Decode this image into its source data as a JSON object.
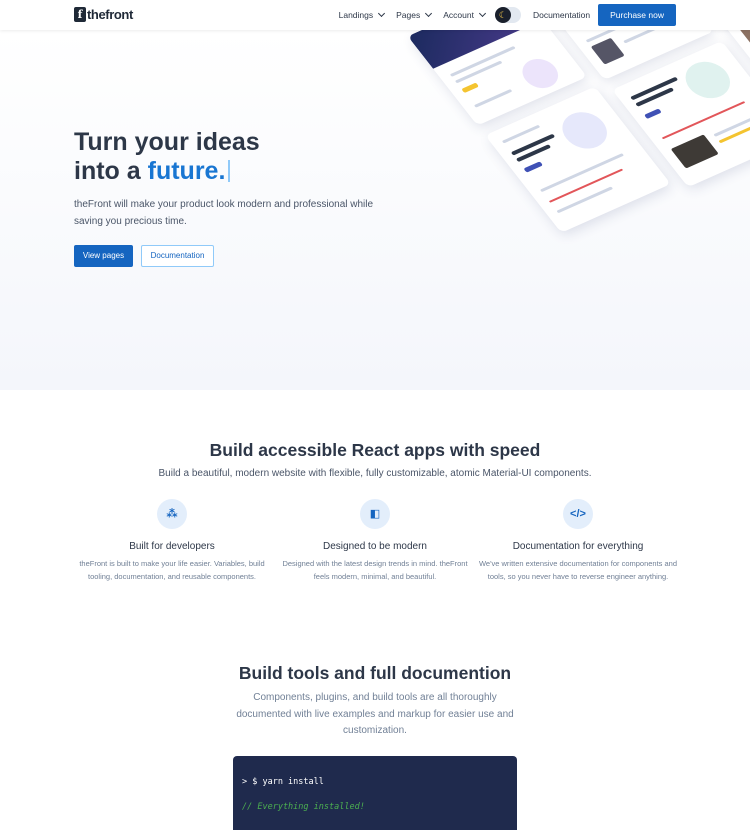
{
  "header": {
    "logo_mark": "f",
    "logo_text": "thefront",
    "nav": [
      {
        "label": "Landings"
      },
      {
        "label": "Pages"
      },
      {
        "label": "Account"
      }
    ],
    "theme_toggle_icon": "moon-icon",
    "documentation": "Documentation",
    "purchase": "Purchase now"
  },
  "hero": {
    "title_line1": "Turn your ideas",
    "title_line2_prefix": "into a",
    "title_accent": "future.",
    "subtitle": "theFront will make your product look modern and professional while saving you precious time.",
    "primary_button": "View pages",
    "secondary_button": "Documentation"
  },
  "features_section": {
    "title": "Build accessible React apps with speed",
    "subtitle": "Build a beautiful, modern website with flexible, fully customizable, atomic Material-UI components.",
    "items": [
      {
        "icon": "cursor-click-icon",
        "glyph": "⁂",
        "title": "Built for developers",
        "description": "theFront is built to make your life easier. Variables, build tooling, documentation, and reusable components."
      },
      {
        "icon": "layout-icon",
        "glyph": "◧",
        "title": "Designed to be modern",
        "description": "Designed with the latest design trends in mind. theFront feels modern, minimal, and beautiful."
      },
      {
        "icon": "code-icon",
        "glyph": "</>",
        "title": "Documentation for everything",
        "description": "We've written extensive documentation for components and tools, so you never have to reverse engineer anything."
      }
    ]
  },
  "tools_section": {
    "title": "Build tools and full documention",
    "subtitle": "Components, plugins, and build tools are all thoroughly documented with live examples and markup for easier use and customization.",
    "code": {
      "command": "> $ yarn install",
      "comment": "// Everything installed!"
    }
  },
  "colors": {
    "accent": "#1976d2",
    "primary_button": "#1565c0",
    "code_background": "#1f2a4d",
    "code_comment": "#4caf50"
  }
}
